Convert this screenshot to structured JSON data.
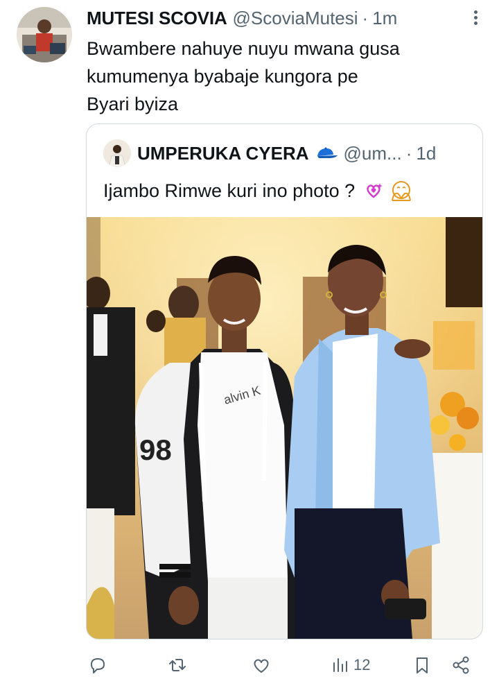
{
  "tweet": {
    "author_name": "MUTESI SCOVIA",
    "author_handle": "@ScoviaMutesi",
    "separator": "·",
    "time": "1m",
    "text_lines": [
      "Bwambere nahuye nuyu mwana gusa",
      "kumumenya byabaje kungora pe",
      "Byari byiza"
    ]
  },
  "quoted": {
    "author_name": "UMPERUKA CYERA",
    "name_emoji": "blue-cap-emoji",
    "author_handle": "@um...",
    "separator": "·",
    "time": "1d",
    "text": "Ijambo Rimwe kuri ino photo ?",
    "text_emojis": [
      "heart-with-sparkles-emoji",
      "face-with-hand-over-mouth-emoji"
    ],
    "photo_shirt_text": "alvin K",
    "photo_jacket_number": "98"
  },
  "actions": {
    "reply_icon": "reply-icon",
    "retweet_icon": "retweet-icon",
    "like_icon": "heart-icon",
    "views_icon": "analytics-icon",
    "views_count": "12",
    "bookmark_icon": "bookmark-icon",
    "share_icon": "share-icon"
  },
  "colors": {
    "text": "#0f1419",
    "secondary": "#536471",
    "border": "#cfd9de",
    "accent_pink": "#d63bd0"
  }
}
